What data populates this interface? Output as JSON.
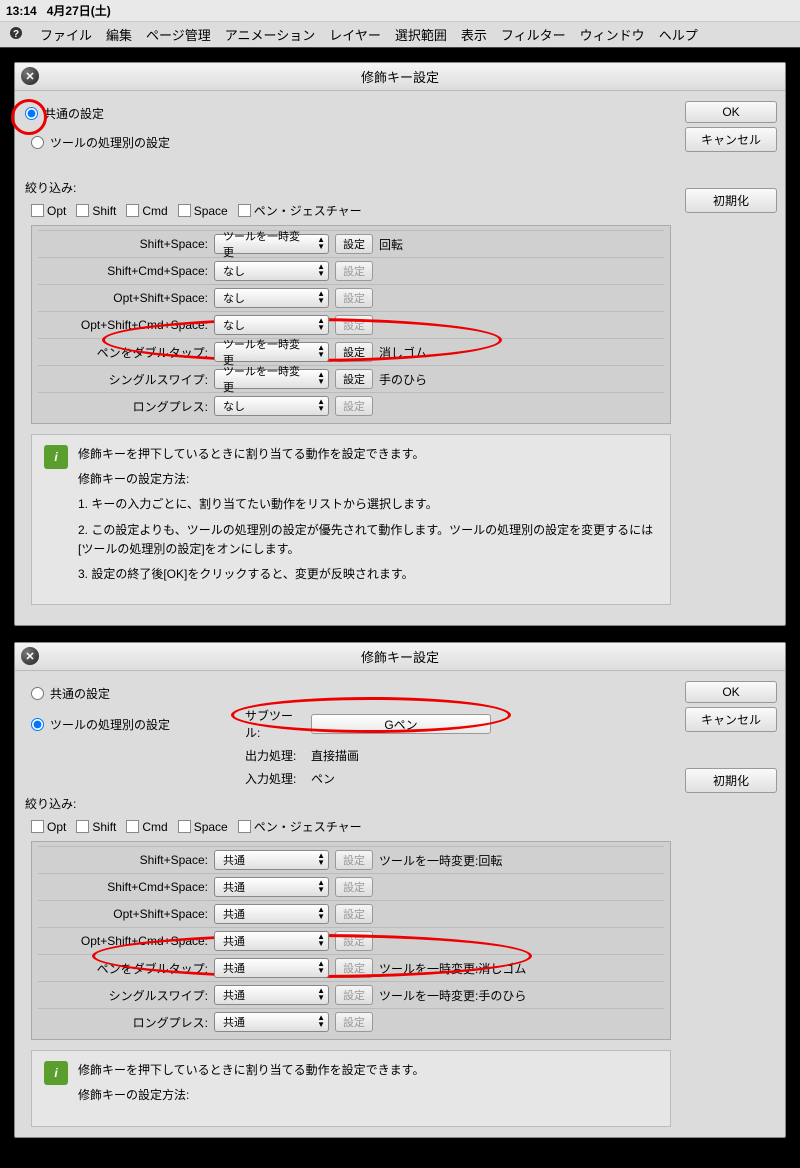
{
  "statusbar": {
    "time": "13:14",
    "date": "4月27日(土)"
  },
  "menubar": {
    "app": "?",
    "items": [
      "ファイル",
      "編集",
      "ページ管理",
      "アニメーション",
      "レイヤー",
      "選択範囲",
      "表示",
      "フィルター",
      "ウィンドウ",
      "ヘルプ"
    ]
  },
  "dialog1": {
    "title": "修飾キー設定",
    "radio_common": "共通の設定",
    "radio_per_tool": "ツールの処理別の設定",
    "filter_label": "絞り込み:",
    "filter_opts": [
      "Opt",
      "Shift",
      "Cmd",
      "Space",
      "ペン・ジェスチャー"
    ],
    "rows": [
      {
        "label": "Shift+Space:",
        "value": "ツールを一時変更",
        "setting": "設定",
        "enabled": true,
        "rest": "回転"
      },
      {
        "label": "Shift+Cmd+Space:",
        "value": "なし",
        "setting": "設定",
        "enabled": false,
        "rest": ""
      },
      {
        "label": "Opt+Shift+Space:",
        "value": "なし",
        "setting": "設定",
        "enabled": false,
        "rest": ""
      },
      {
        "label": "Opt+Shift+Cmd+Space:",
        "value": "なし",
        "setting": "設定",
        "enabled": false,
        "rest": ""
      },
      {
        "label": "ペンをダブルタップ:",
        "value": "ツールを一時変更",
        "setting": "設定",
        "enabled": true,
        "rest": "消しゴム"
      },
      {
        "label": "シングルスワイプ:",
        "value": "ツールを一時変更",
        "setting": "設定",
        "enabled": true,
        "rest": "手のひら"
      },
      {
        "label": "ロングプレス:",
        "value": "なし",
        "setting": "設定",
        "enabled": false,
        "rest": ""
      }
    ],
    "buttons": {
      "ok": "OK",
      "cancel": "キャンセル",
      "reset": "初期化"
    },
    "info": {
      "p1": "修飾キーを押下しているときに割り当てる動作を設定できます。",
      "p2": "修飾キーの設定方法:",
      "p3": "1. キーの入力ごとに、割り当てたい動作をリストから選択します。",
      "p4": "2. この設定よりも、ツールの処理別の設定が優先されて動作します。ツールの処理別の設定を変更するには[ツールの処理別の設定]をオンにします。",
      "p5": "3. 設定の終了後[OK]をクリックすると、変更が反映されます。"
    }
  },
  "dialog2": {
    "title": "修飾キー設定",
    "radio_common": "共通の設定",
    "radio_per_tool": "ツールの処理別の設定",
    "subtool_label": "サブツール:",
    "subtool_value": "Gペン",
    "output_label": "出力処理:",
    "output_value": "直接描画",
    "input_label": "入力処理:",
    "input_value": "ペン",
    "filter_label": "絞り込み:",
    "filter_opts": [
      "Opt",
      "Shift",
      "Cmd",
      "Space",
      "ペン・ジェスチャー"
    ],
    "rows": [
      {
        "label": "Shift+Space:",
        "value": "共通",
        "setting": "設定",
        "enabled": false,
        "rest": "ツールを一時変更:回転"
      },
      {
        "label": "Shift+Cmd+Space:",
        "value": "共通",
        "setting": "設定",
        "enabled": false,
        "rest": ""
      },
      {
        "label": "Opt+Shift+Space:",
        "value": "共通",
        "setting": "設定",
        "enabled": false,
        "rest": ""
      },
      {
        "label": "Opt+Shift+Cmd+Space:",
        "value": "共通",
        "setting": "設定",
        "enabled": false,
        "rest": ""
      },
      {
        "label": "ペンをダブルタップ:",
        "value": "共通",
        "setting": "設定",
        "enabled": false,
        "rest": "ツールを一時変更:消しゴム"
      },
      {
        "label": "シングルスワイプ:",
        "value": "共通",
        "setting": "設定",
        "enabled": false,
        "rest": "ツールを一時変更:手のひら"
      },
      {
        "label": "ロングプレス:",
        "value": "共通",
        "setting": "設定",
        "enabled": false,
        "rest": ""
      }
    ],
    "buttons": {
      "ok": "OK",
      "cancel": "キャンセル",
      "reset": "初期化"
    },
    "info": {
      "p1": "修飾キーを押下しているときに割り当てる動作を設定できます。",
      "p2": "修飾キーの設定方法:"
    }
  }
}
